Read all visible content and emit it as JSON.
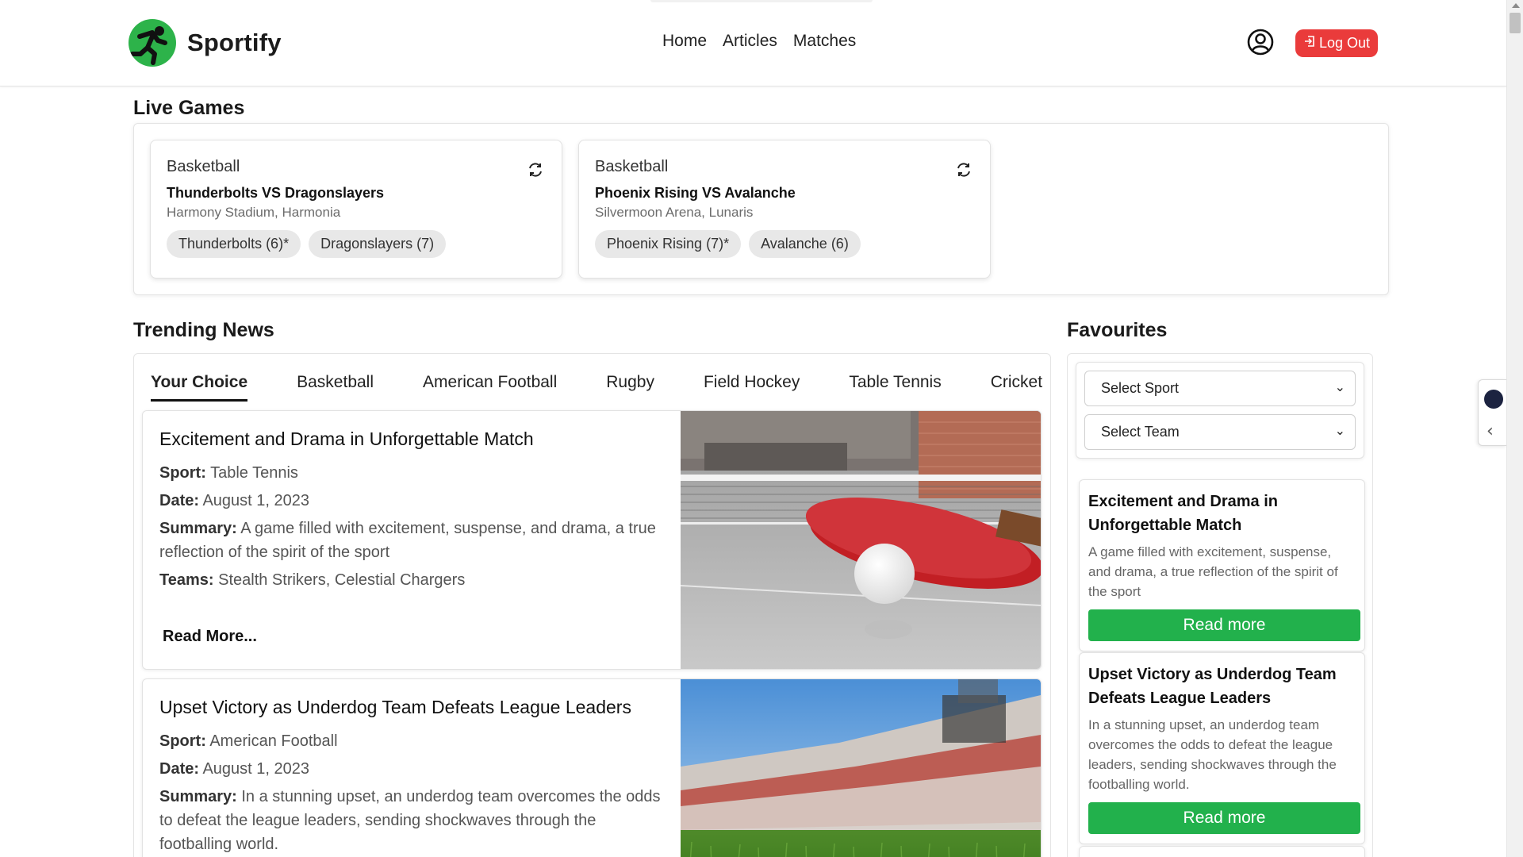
{
  "header": {
    "brand": "Sportify",
    "nav": [
      "Home",
      "Articles",
      "Matches"
    ],
    "logout_label": "Log Out"
  },
  "live_games": {
    "title": "Live Games",
    "games": [
      {
        "sport": "Basketball",
        "matchup": "Thunderbolts VS Dragonslayers",
        "venue": "Harmony Stadium, Harmonia",
        "team_a": "Thunderbolts (6)*",
        "team_b": "Dragonslayers (7)"
      },
      {
        "sport": "Basketball",
        "matchup": "Phoenix Rising VS Avalanche",
        "venue": "Silvermoon Arena, Lunaris",
        "team_a": "Phoenix Rising (7)*",
        "team_b": "Avalanche (6)"
      }
    ]
  },
  "trending": {
    "title": "Trending News",
    "tabs": [
      "Your Choice",
      "Basketball",
      "American Football",
      "Rugby",
      "Field Hockey",
      "Table Tennis",
      "Cricket"
    ],
    "articles": [
      {
        "title": "Excitement and Drama in Unforgettable Match",
        "sport_label": "Sport:",
        "sport": "Table Tennis",
        "date_label": "Date:",
        "date": "August 1, 2023",
        "summary_label": "Summary:",
        "summary": "A game filled with excitement, suspense, and drama, a true reflection of the spirit of the sport",
        "teams_label": "Teams:",
        "teams": "Stealth Strikers, Celestial Chargers",
        "read_more": "Read More..."
      },
      {
        "title": "Upset Victory as Underdog Team Defeats League Leaders",
        "sport_label": "Sport:",
        "sport": "American Football",
        "date_label": "Date:",
        "date": "August 1, 2023",
        "summary_label": "Summary:",
        "summary": "In a stunning upset, an underdog team overcomes the odds to defeat the league leaders, sending shockwaves through the footballing world."
      }
    ]
  },
  "favourites": {
    "title": "Favourites",
    "select_sport": "Select Sport",
    "select_team": "Select Team",
    "cards": [
      {
        "title": "Excitement and Drama in Unforgettable Match",
        "summary": "A game filled with excitement, suspense, and drama, a true reflection of the spirit of the sport",
        "button": "Read more"
      },
      {
        "title": "Upset Victory as Underdog Team Defeats League Leaders",
        "summary": "In a stunning upset, an underdog team overcomes the odds to defeat the league leaders, sending shockwaves through the footballing world.",
        "button": "Read more"
      }
    ]
  },
  "colors": {
    "brand_green": "#22b14c",
    "logout_red": "#ea3b3b"
  },
  "icons": {
    "logo": "runner-logo-icon",
    "user": "user-circle-icon",
    "refresh": "refresh-icon",
    "logout": "logout-icon",
    "caret": "chevron-down-icon"
  }
}
